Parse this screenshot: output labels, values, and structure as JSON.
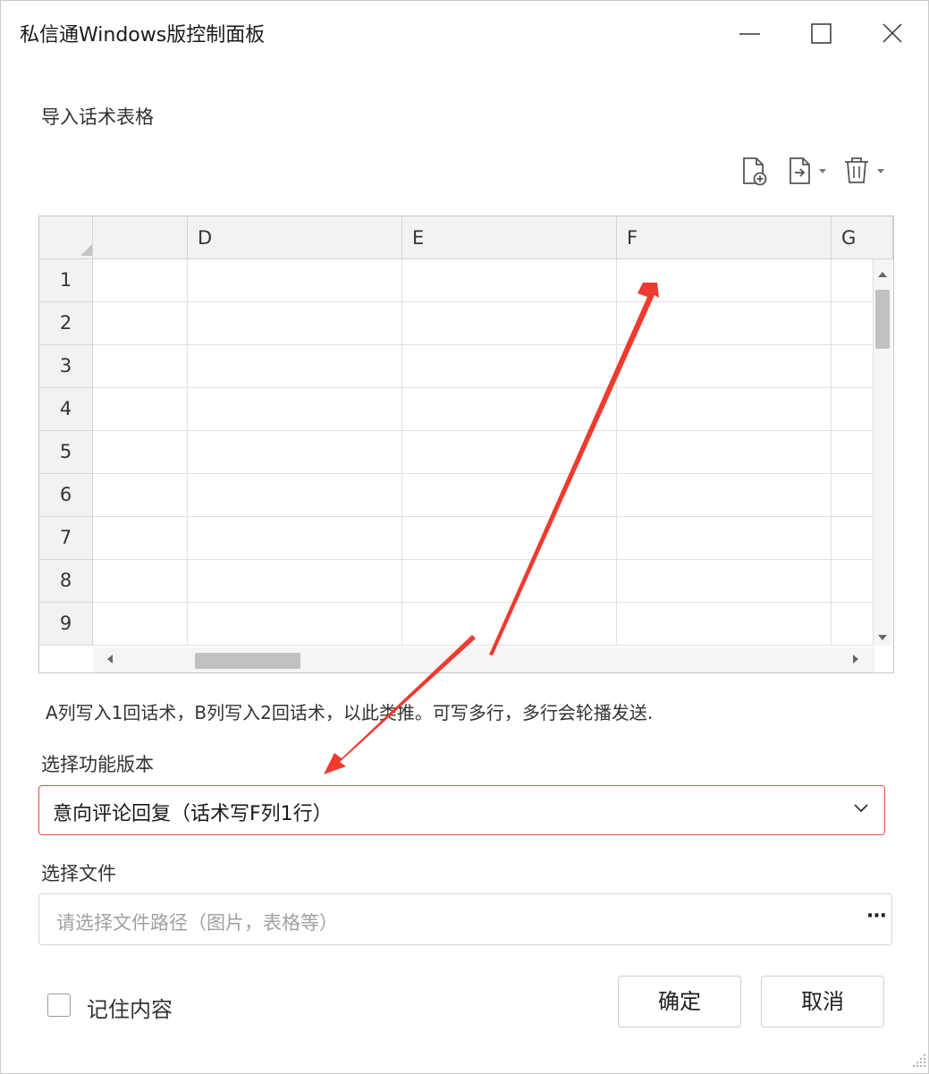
{
  "window": {
    "title": "私信通Windows版控制面板"
  },
  "import_section": {
    "label": "导入话术表格"
  },
  "toolbar": {
    "icons": [
      "add-file-icon",
      "import-file-icon",
      "delete-icon"
    ]
  },
  "spreadsheet": {
    "columns": [
      "D",
      "E",
      "F",
      "G"
    ],
    "rows": [
      "1",
      "2",
      "3",
      "4",
      "5",
      "6",
      "7",
      "8",
      "9"
    ]
  },
  "hint": {
    "text": "A列写入1回话术，B列写入2回话术，以此类推。可写多行，多行会轮播发送."
  },
  "version": {
    "label": "选择功能版本",
    "selected": "意向评论回复（话术写F列1行）"
  },
  "file": {
    "label": "选择文件",
    "placeholder": "请选择文件路径（图片，表格等）",
    "more": "···"
  },
  "remember": {
    "label": "记住内容",
    "checked": false
  },
  "buttons": {
    "confirm": "确定",
    "cancel": "取消"
  },
  "colors": {
    "annotation_arrow": "#f03a2e",
    "dropdown_border": "#e0534c"
  }
}
